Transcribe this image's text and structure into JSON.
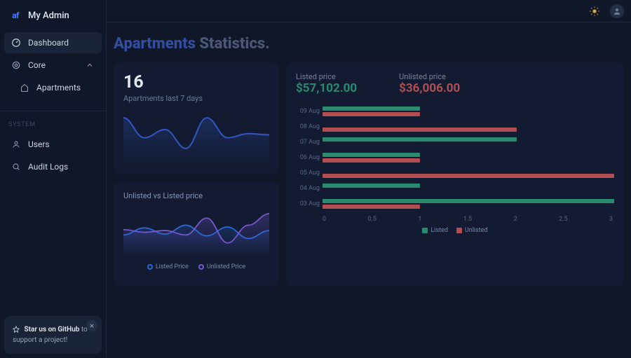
{
  "brand": {
    "logo": "af",
    "title": "My Admin"
  },
  "nav": {
    "dashboard": "Dashboard",
    "core": "Core",
    "apartments": "Apartments",
    "system_label": "SYSTEM",
    "users": "Users",
    "audit": "Audit Logs"
  },
  "gh": {
    "strong": "Star us on GitHub",
    "rest": " to support a project!",
    "close": "×"
  },
  "page": {
    "accent": "Apartments",
    "muted": " Statistics."
  },
  "kpi": {
    "value": "16",
    "label": "Apartments last 7 days"
  },
  "card2": {
    "title": "Unlisted vs Listed price",
    "legend_listed": "Listed Price",
    "legend_unlisted": "Unlisted Price"
  },
  "prices": {
    "listed_label": "Listed price",
    "listed_value": "$57,102.00",
    "unlisted_label": "Unlisted price",
    "unlisted_value": "$36,006.00"
  },
  "legend3": {
    "listed": "Listed",
    "unlisted": "Unlisted"
  },
  "chart_data": {
    "kpi_line": {
      "type": "line",
      "x": [
        0,
        1,
        2,
        3,
        4,
        5,
        6,
        7
      ],
      "values": [
        72,
        38,
        52,
        20,
        72,
        38,
        45,
        43
      ]
    },
    "vs_price": {
      "type": "line",
      "x": [
        0,
        1,
        2,
        3,
        4,
        5,
        6,
        7
      ],
      "series": [
        {
          "name": "Listed Price",
          "color": "#2d68d8",
          "values": [
            40,
            56,
            42,
            62,
            38,
            58,
            32,
            50
          ]
        },
        {
          "name": "Unlisted Price",
          "color": "#7657cf",
          "values": [
            52,
            46,
            50,
            40,
            78,
            22,
            62,
            88
          ]
        }
      ]
    },
    "hbars": {
      "type": "bar",
      "orientation": "horizontal",
      "xlabel": "",
      "ylabel": "",
      "xlim": [
        0,
        3
      ],
      "ticks": [
        "0",
        "0.5",
        "1",
        "1.5",
        "2",
        "2.5",
        "3"
      ],
      "categories": [
        "09 Aug",
        "08 Aug",
        "07 Aug",
        "06 Aug",
        "05 Aug",
        "04 Aug",
        "03 Aug"
      ],
      "series": [
        {
          "name": "Listed",
          "color": "#2b8a6e",
          "values": [
            1.0,
            0.0,
            2.0,
            1.0,
            0.0,
            1.0,
            3.0
          ]
        },
        {
          "name": "Unlisted",
          "color": "#b24e52",
          "values": [
            1.0,
            2.0,
            0.0,
            1.0,
            3.0,
            0.0,
            1.0
          ]
        }
      ]
    }
  }
}
